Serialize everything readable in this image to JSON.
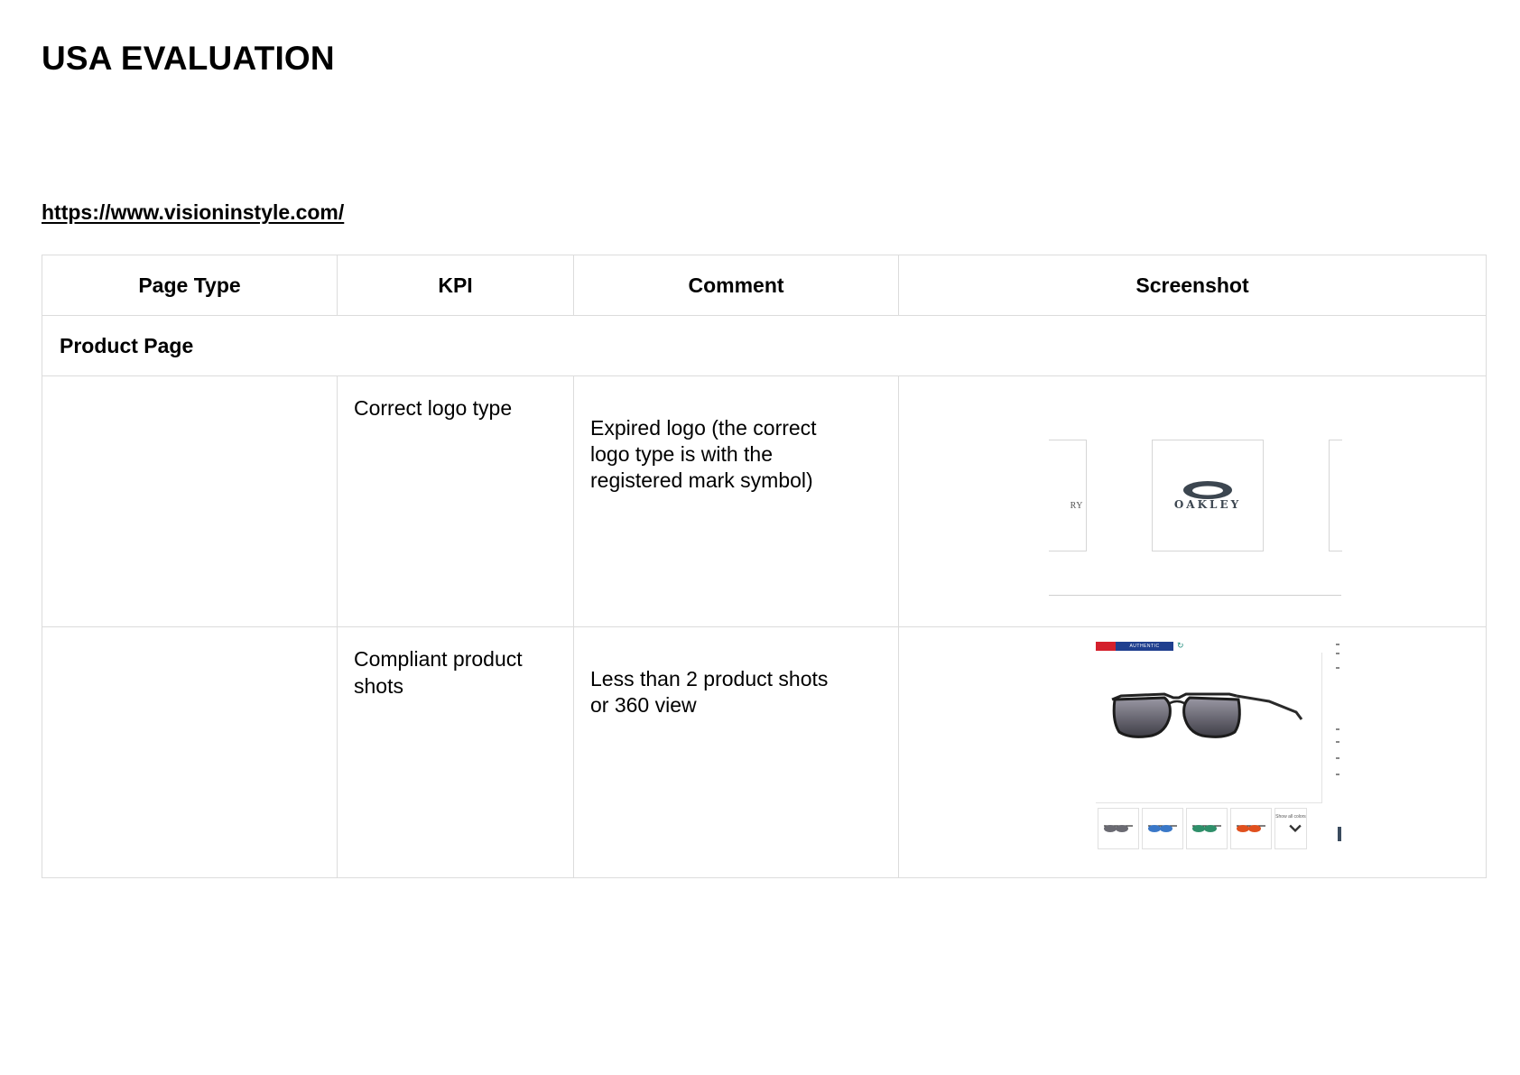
{
  "page": {
    "title": "USA EVALUATION",
    "link": "https://www.visioninstyle.com/"
  },
  "table": {
    "headers": {
      "page_type": "Page Type",
      "kpi": "KPI",
      "comment": "Comment",
      "screenshot": "Screenshot"
    },
    "section": "Product Page",
    "rows": [
      {
        "page_type": "",
        "kpi": "Correct logo type",
        "comment": "Expired logo (the correct logo type is with the registered mark symbol)"
      },
      {
        "page_type": "",
        "kpi": "Compliant product shots",
        "comment": "Less than 2 product shots or 360 view"
      }
    ]
  },
  "screenshots": {
    "logo": {
      "left_partial_text": "RY",
      "brand_text": "OAKLEY",
      "brand_color": "#3c4650",
      "icon": "oakley-ellipse-logo-icon"
    },
    "product": {
      "badge_text": "AUTHENTIC",
      "badge_colors": [
        "#d4202c",
        "#1f3f8f"
      ],
      "more_label": "Show all colors",
      "thumbnail_lens_colors": [
        "#6a6a72",
        "#3a78c8",
        "#2f8f6a",
        "#e0501e"
      ],
      "icons": [
        "sunglasses-image-icon",
        "chevron-down-icon"
      ]
    }
  }
}
